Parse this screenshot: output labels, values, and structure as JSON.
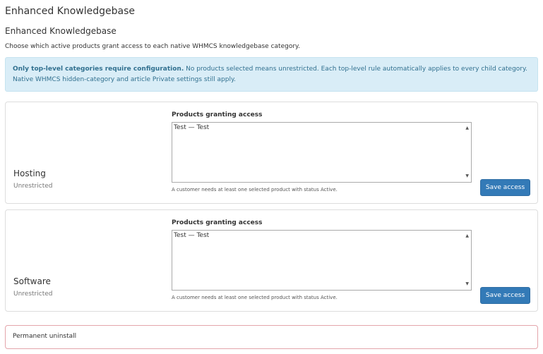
{
  "page": {
    "title": "Enhanced Knowledgebase",
    "subtitle": "Enhanced Knowledgebase",
    "description": "Choose which active products grant access to each native WHMCS knowledgebase category."
  },
  "info": {
    "bold": "Only top-level categories require configuration.",
    "rest": " No products selected means unrestricted. Each top-level rule automatically applies to every child category. Native WHMCS hidden-category and article Private settings still apply."
  },
  "categories": [
    {
      "name": "Hosting",
      "status": "Unrestricted",
      "field_label": "Products granting access",
      "options": [
        "Test — Test"
      ],
      "help": "A customer needs at least one selected product with status Active.",
      "save_label": "Save access"
    },
    {
      "name": "Software",
      "status": "Unrestricted",
      "field_label": "Products granting access",
      "options": [
        "Test — Test"
      ],
      "help": "A customer needs at least one selected product with status Active.",
      "save_label": "Save access"
    }
  ],
  "danger": {
    "label": "Permanent uninstall"
  }
}
